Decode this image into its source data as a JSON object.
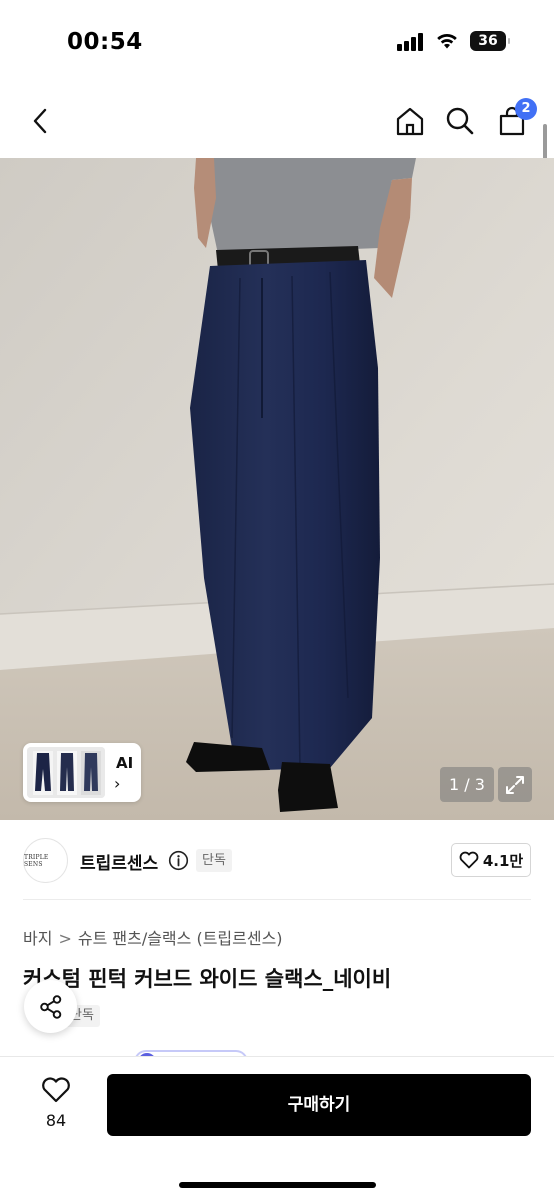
{
  "status_bar": {
    "time": "00:54",
    "battery": "36"
  },
  "nav": {
    "back_icon": "chevron-left-icon",
    "home_icon": "home-icon",
    "search_icon": "search-icon",
    "cart_icon": "shopping-bag-icon",
    "cart_count": "2",
    "badge_color": "#4170f5"
  },
  "gallery": {
    "ai_label": "AI",
    "ai_chevron": "›",
    "page_counter": "1 / 3",
    "expand_icon": "expand-icon"
  },
  "shop": {
    "logo_text": "TRIPLE SENS",
    "name": "트립르센스",
    "info_icon": "info-icon",
    "exclusive_label": "단독",
    "like_count": "4.1만"
  },
  "product": {
    "breadcrumb": [
      "바지",
      "슈트 팬츠/슬랙스 (트립르센스)"
    ],
    "breadcrumb_separator": ">",
    "title": "커스텀 핀턱 커브드 와이드 슬랙스_네이비",
    "exclusive_label": "단독"
  },
  "share": {
    "icon": "share-icon"
  },
  "bottom_bar": {
    "wish_icon": "heart-icon",
    "wish_count": "84",
    "buy_label": "구매하기"
  }
}
